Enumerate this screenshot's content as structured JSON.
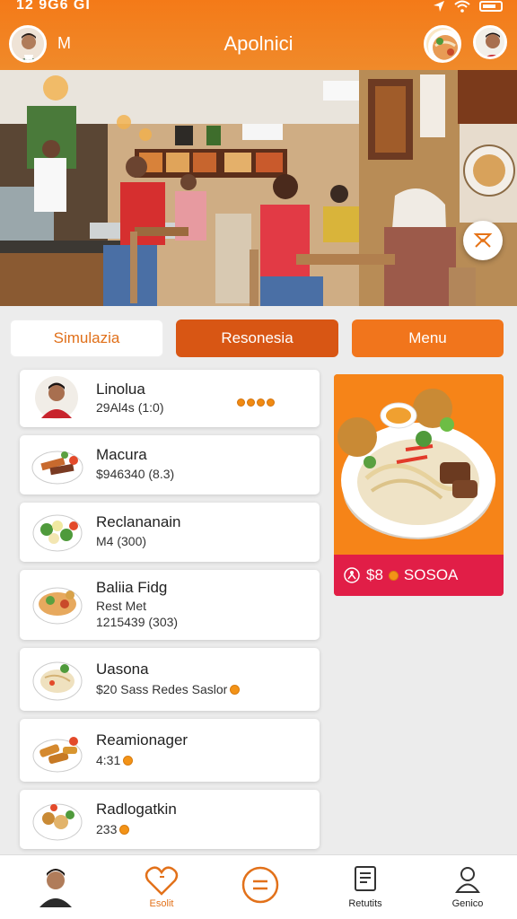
{
  "status": {
    "time": "12 9G6 GI"
  },
  "header": {
    "initial": "M",
    "title": "Apolnici"
  },
  "tabs": [
    "Simulazia",
    "Resonesia",
    "Menu"
  ],
  "list": [
    {
      "name": "Linolua",
      "line1": "29Al4s (1:0)"
    },
    {
      "name": "Macura",
      "line1": "$946340 (8.3)"
    },
    {
      "name": "Reclananain",
      "line1": "M4 (300)"
    },
    {
      "name": "Baliia Fidg",
      "line1": "Rest Met",
      "line2": "1215439 (303)"
    },
    {
      "name": "Uasona",
      "line1": "$20 Sass Redes Saslor"
    },
    {
      "name": "Reamionager",
      "line1": "4:31"
    },
    {
      "name": "Radlogatkin",
      "line1": "233"
    }
  ],
  "feature": {
    "price": "$8",
    "label": "SOSOA"
  },
  "nav": [
    {
      "label": ""
    },
    {
      "label": "Esolit"
    },
    {
      "label": ""
    },
    {
      "label": "Retutits"
    },
    {
      "label": "Genico"
    }
  ],
  "colors": {
    "brand": "#f47a18",
    "accent_dark": "#d85614",
    "feature_bar": "#e11e47"
  }
}
